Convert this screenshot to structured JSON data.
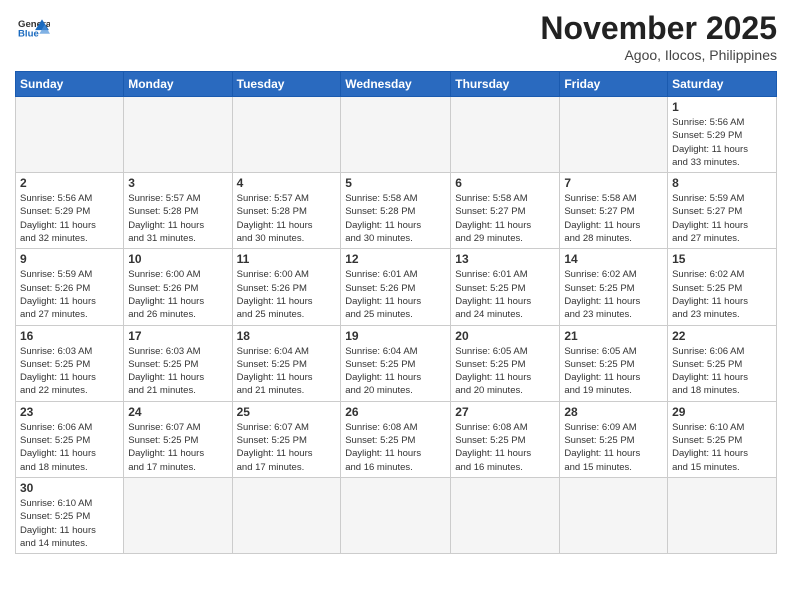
{
  "header": {
    "logo_line1": "General",
    "logo_line2": "Blue",
    "month_title": "November 2025",
    "location": "Agoo, Ilocos, Philippines"
  },
  "weekdays": [
    "Sunday",
    "Monday",
    "Tuesday",
    "Wednesday",
    "Thursday",
    "Friday",
    "Saturday"
  ],
  "weeks": [
    [
      {
        "day": "",
        "info": ""
      },
      {
        "day": "",
        "info": ""
      },
      {
        "day": "",
        "info": ""
      },
      {
        "day": "",
        "info": ""
      },
      {
        "day": "",
        "info": ""
      },
      {
        "day": "",
        "info": ""
      },
      {
        "day": "1",
        "info": "Sunrise: 5:56 AM\nSunset: 5:29 PM\nDaylight: 11 hours\nand 33 minutes."
      }
    ],
    [
      {
        "day": "2",
        "info": "Sunrise: 5:56 AM\nSunset: 5:29 PM\nDaylight: 11 hours\nand 32 minutes."
      },
      {
        "day": "3",
        "info": "Sunrise: 5:57 AM\nSunset: 5:28 PM\nDaylight: 11 hours\nand 31 minutes."
      },
      {
        "day": "4",
        "info": "Sunrise: 5:57 AM\nSunset: 5:28 PM\nDaylight: 11 hours\nand 30 minutes."
      },
      {
        "day": "5",
        "info": "Sunrise: 5:58 AM\nSunset: 5:28 PM\nDaylight: 11 hours\nand 30 minutes."
      },
      {
        "day": "6",
        "info": "Sunrise: 5:58 AM\nSunset: 5:27 PM\nDaylight: 11 hours\nand 29 minutes."
      },
      {
        "day": "7",
        "info": "Sunrise: 5:58 AM\nSunset: 5:27 PM\nDaylight: 11 hours\nand 28 minutes."
      },
      {
        "day": "8",
        "info": "Sunrise: 5:59 AM\nSunset: 5:27 PM\nDaylight: 11 hours\nand 27 minutes."
      }
    ],
    [
      {
        "day": "9",
        "info": "Sunrise: 5:59 AM\nSunset: 5:26 PM\nDaylight: 11 hours\nand 27 minutes."
      },
      {
        "day": "10",
        "info": "Sunrise: 6:00 AM\nSunset: 5:26 PM\nDaylight: 11 hours\nand 26 minutes."
      },
      {
        "day": "11",
        "info": "Sunrise: 6:00 AM\nSunset: 5:26 PM\nDaylight: 11 hours\nand 25 minutes."
      },
      {
        "day": "12",
        "info": "Sunrise: 6:01 AM\nSunset: 5:26 PM\nDaylight: 11 hours\nand 25 minutes."
      },
      {
        "day": "13",
        "info": "Sunrise: 6:01 AM\nSunset: 5:25 PM\nDaylight: 11 hours\nand 24 minutes."
      },
      {
        "day": "14",
        "info": "Sunrise: 6:02 AM\nSunset: 5:25 PM\nDaylight: 11 hours\nand 23 minutes."
      },
      {
        "day": "15",
        "info": "Sunrise: 6:02 AM\nSunset: 5:25 PM\nDaylight: 11 hours\nand 23 minutes."
      }
    ],
    [
      {
        "day": "16",
        "info": "Sunrise: 6:03 AM\nSunset: 5:25 PM\nDaylight: 11 hours\nand 22 minutes."
      },
      {
        "day": "17",
        "info": "Sunrise: 6:03 AM\nSunset: 5:25 PM\nDaylight: 11 hours\nand 21 minutes."
      },
      {
        "day": "18",
        "info": "Sunrise: 6:04 AM\nSunset: 5:25 PM\nDaylight: 11 hours\nand 21 minutes."
      },
      {
        "day": "19",
        "info": "Sunrise: 6:04 AM\nSunset: 5:25 PM\nDaylight: 11 hours\nand 20 minutes."
      },
      {
        "day": "20",
        "info": "Sunrise: 6:05 AM\nSunset: 5:25 PM\nDaylight: 11 hours\nand 20 minutes."
      },
      {
        "day": "21",
        "info": "Sunrise: 6:05 AM\nSunset: 5:25 PM\nDaylight: 11 hours\nand 19 minutes."
      },
      {
        "day": "22",
        "info": "Sunrise: 6:06 AM\nSunset: 5:25 PM\nDaylight: 11 hours\nand 18 minutes."
      }
    ],
    [
      {
        "day": "23",
        "info": "Sunrise: 6:06 AM\nSunset: 5:25 PM\nDaylight: 11 hours\nand 18 minutes."
      },
      {
        "day": "24",
        "info": "Sunrise: 6:07 AM\nSunset: 5:25 PM\nDaylight: 11 hours\nand 17 minutes."
      },
      {
        "day": "25",
        "info": "Sunrise: 6:07 AM\nSunset: 5:25 PM\nDaylight: 11 hours\nand 17 minutes."
      },
      {
        "day": "26",
        "info": "Sunrise: 6:08 AM\nSunset: 5:25 PM\nDaylight: 11 hours\nand 16 minutes."
      },
      {
        "day": "27",
        "info": "Sunrise: 6:08 AM\nSunset: 5:25 PM\nDaylight: 11 hours\nand 16 minutes."
      },
      {
        "day": "28",
        "info": "Sunrise: 6:09 AM\nSunset: 5:25 PM\nDaylight: 11 hours\nand 15 minutes."
      },
      {
        "day": "29",
        "info": "Sunrise: 6:10 AM\nSunset: 5:25 PM\nDaylight: 11 hours\nand 15 minutes."
      }
    ],
    [
      {
        "day": "30",
        "info": "Sunrise: 6:10 AM\nSunset: 5:25 PM\nDaylight: 11 hours\nand 14 minutes."
      },
      {
        "day": "",
        "info": ""
      },
      {
        "day": "",
        "info": ""
      },
      {
        "day": "",
        "info": ""
      },
      {
        "day": "",
        "info": ""
      },
      {
        "day": "",
        "info": ""
      },
      {
        "day": "",
        "info": ""
      }
    ]
  ]
}
